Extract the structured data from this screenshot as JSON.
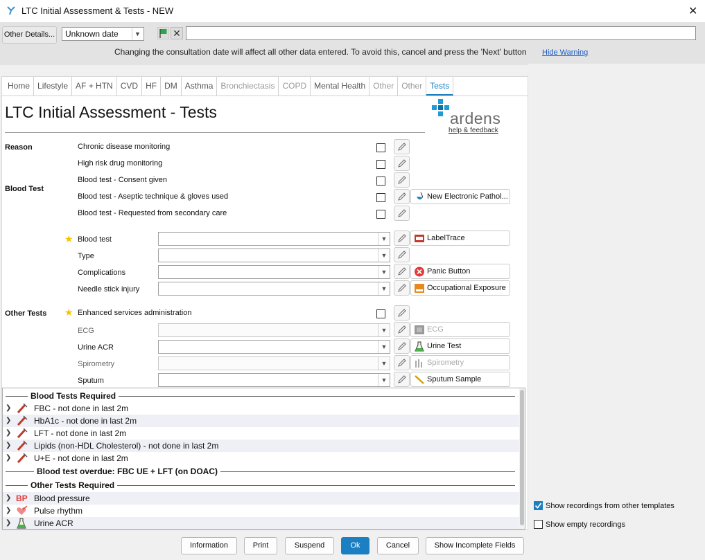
{
  "window": {
    "title": "LTC Initial Assessment & Tests - NEW"
  },
  "toolbar": {
    "other_details": "Other Details...",
    "date_value": "Unknown date",
    "warning": "Changing the consultation date will affect all other data entered. To avoid this, cancel and press the 'Next' button",
    "hide_warning": "Hide Warning"
  },
  "tabs": [
    {
      "label": "Home",
      "state": "normal"
    },
    {
      "label": "Lifestyle",
      "state": "normal"
    },
    {
      "label": "AF + HTN",
      "state": "normal"
    },
    {
      "label": "CVD",
      "state": "normal"
    },
    {
      "label": "HF",
      "state": "normal"
    },
    {
      "label": "DM",
      "state": "normal"
    },
    {
      "label": "Asthma",
      "state": "normal"
    },
    {
      "label": "Bronchiectasis",
      "state": "disabled"
    },
    {
      "label": "COPD",
      "state": "disabled"
    },
    {
      "label": "Mental Health",
      "state": "normal"
    },
    {
      "label": "Other",
      "state": "disabled"
    },
    {
      "label": "Other",
      "state": "disabled"
    },
    {
      "label": "Tests",
      "state": "active"
    }
  ],
  "page": {
    "title": "LTC Initial Assessment - Tests",
    "logo_text": "ardens",
    "help": "help & feedback"
  },
  "sections": {
    "reason": "Reason",
    "blood_test": "Blood Test",
    "other_tests": "Other Tests"
  },
  "checkbox_rows": [
    "Chronic disease monitoring",
    "High risk drug monitoring",
    "Blood test - Consent given",
    "Blood test - Aseptic technique & gloves used",
    "Blood test - Requested from secondary care"
  ],
  "combo_rows": [
    "Blood test",
    "Type",
    "Complications",
    "Needle stick injury"
  ],
  "enhanced_services": "Enhanced services administration",
  "other_combo_rows": [
    "ECG",
    "Urine ACR",
    "Spirometry",
    "Sputum"
  ],
  "ext_buttons": {
    "pathology": "New Electronic Pathol...",
    "labeltrace": "LabelTrace",
    "panic": "Panic Button",
    "occupational": "Occupational Exposure",
    "ecg": "ECG",
    "urine": "Urine Test",
    "spirometry": "Spirometry",
    "sputum": "Sputum Sample"
  },
  "list": {
    "blood_header": "Blood Tests Required",
    "blood_items": [
      "FBC - not done in last 2m",
      "HbA1c - not done in last 2m",
      "LFT - not done in last 2m",
      "Lipids (non-HDL Cholesterol) - not done in last 2m",
      "U+E - not done in last 2m"
    ],
    "overdue_header": "Blood test overdue: FBC UE + LFT (on DOAC)",
    "other_header": "Other Tests Required",
    "other_items": [
      "Blood pressure",
      "Pulse rhythm",
      "Urine ACR"
    ],
    "bp_glyph": "BP"
  },
  "options": {
    "show_other": "Show recordings from other templates",
    "show_empty": "Show empty recordings"
  },
  "footer": {
    "information": "Information",
    "print": "Print",
    "suspend": "Suspend",
    "ok": "Ok",
    "cancel": "Cancel",
    "incomplete": "Show Incomplete Fields"
  },
  "colors": {
    "accent": "#1c7fc2",
    "star": "#f5c400",
    "panic": "#e23b3b",
    "tube": "#c0392b"
  }
}
